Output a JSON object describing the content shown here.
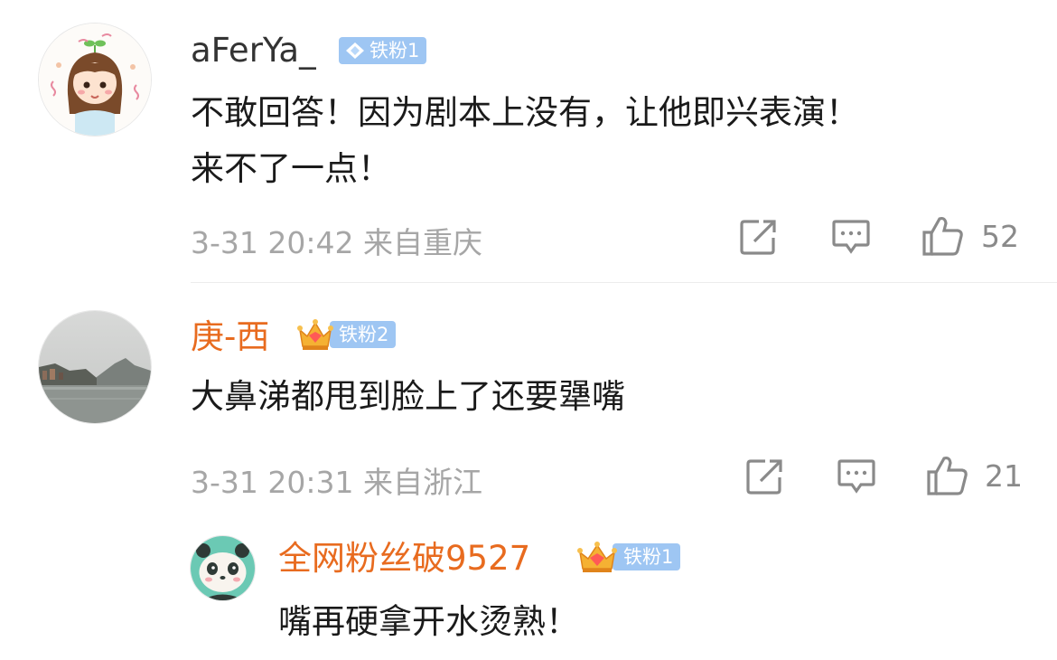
{
  "comments": [
    {
      "username": "aFerYa_",
      "badge": "铁粉1",
      "text_line1": "不敢回答！因为剧本上没有，让他即兴表演！",
      "text_line2": "来不了一点！",
      "meta": "3-31 20:42 来自重庆",
      "likes": "52"
    },
    {
      "username": "庚-西",
      "badge": "铁粉2",
      "text": "大鼻涕都甩到脸上了还要犟嘴",
      "meta": "3-31 20:31 来自浙江",
      "likes": "21"
    }
  ],
  "reply": {
    "username": "全网粉丝破9527",
    "badge": "铁粉1",
    "text": "嘴再硬拿开水烫熟！"
  },
  "colors": {
    "username_default": "#333333",
    "username_highlight": "#e86b1f",
    "badge_bg": "#9ec6f3",
    "meta_text": "#a6a6a6"
  }
}
